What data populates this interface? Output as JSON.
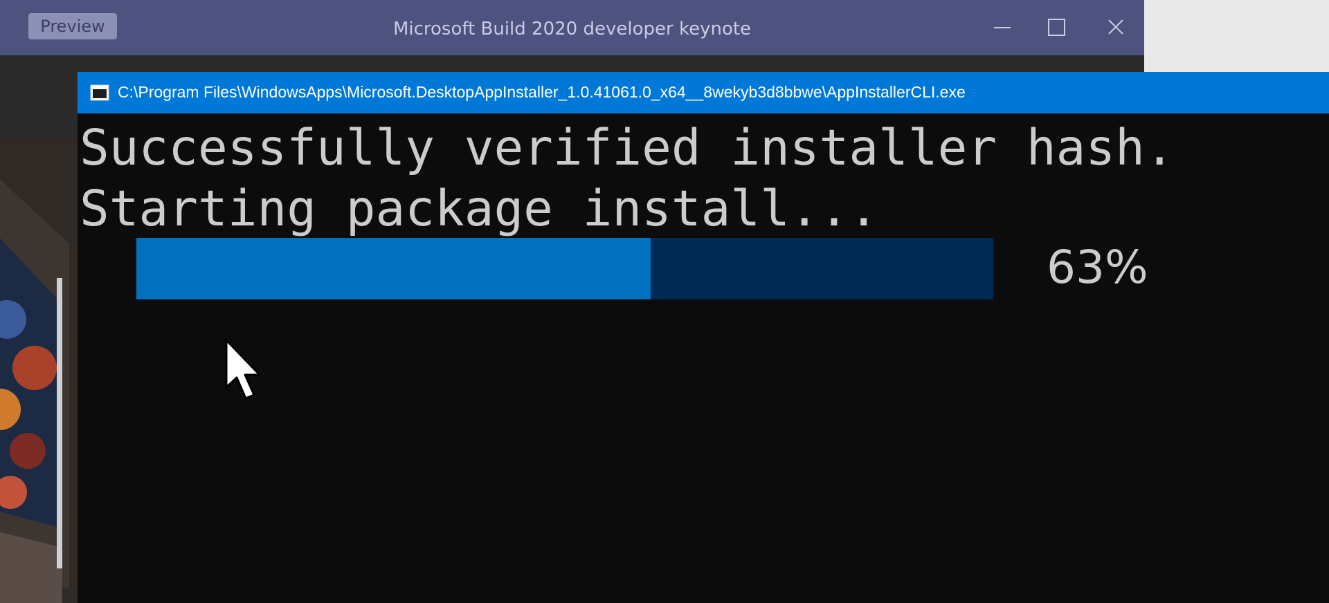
{
  "background_window": {
    "badge": "Preview",
    "title": "Microsoft Build 2020 developer keynote"
  },
  "console": {
    "title": "C:\\Program Files\\WindowsApps\\Microsoft.DesktopAppInstaller_1.0.41061.0_x64__8wekyb3d8bbwe\\AppInstallerCLI.exe",
    "lines": [
      "Successfully verified installer hash.",
      "Starting package install..."
    ],
    "progress": {
      "fraction": 0.6,
      "label": "63%"
    }
  },
  "colors": {
    "console_titlebar": "#0078d7",
    "console_bg": "#0c0c0c",
    "progress_fill": "#0070bf",
    "progress_track": "#002a51",
    "teams_titlebar": "#4e527f"
  },
  "icons": [
    "console-window-icon",
    "minimize-icon",
    "maximize-icon",
    "close-icon",
    "mouse-pointer-icon"
  ]
}
